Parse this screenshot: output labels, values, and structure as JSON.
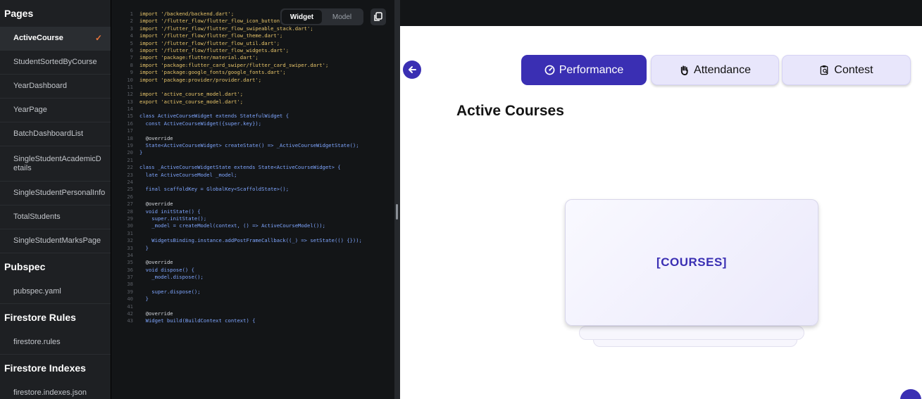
{
  "sidebar": {
    "pages_title": "Pages",
    "pages": [
      {
        "label": "ActiveCourse"
      },
      {
        "label": "StudentSortedByCourse"
      },
      {
        "label": "YearDashboard"
      },
      {
        "label": "YearPage"
      },
      {
        "label": "BatchDashboardList"
      },
      {
        "label": "SingleStudentAcademicDetails"
      },
      {
        "label": "SingleStudentPersonalInfo"
      },
      {
        "label": "TotalStudents"
      },
      {
        "label": "SingleStudentMarksPage"
      }
    ],
    "pubspec_title": "Pubspec",
    "pubspec_file": "pubspec.yaml",
    "rules_title": "Firestore Rules",
    "rules_file": "firestore.rules",
    "indexes_title": "Firestore Indexes",
    "indexes_file": "firestore.indexes.json"
  },
  "code": {
    "toggle": {
      "widget": "Widget",
      "model": "Model"
    },
    "lines": [
      "import '/backend/backend.dart';",
      "import '/flutter_flow/flutter_flow_icon_button.dart';",
      "import '/flutter_flow/flutter_flow_swipeable_stack.dart';",
      "import '/flutter_flow/flutter_flow_theme.dart';",
      "import '/flutter_flow/flutter_flow_util.dart';",
      "import '/flutter_flow/flutter_flow_widgets.dart';",
      "import 'package:flutter/material.dart';",
      "import 'package:flutter_card_swiper/flutter_card_swiper.dart';",
      "import 'package:google_fonts/google_fonts.dart';",
      "import 'package:provider/provider.dart';",
      "",
      "import 'active_course_model.dart';",
      "export 'active_course_model.dart';",
      "",
      "class ActiveCourseWidget extends StatefulWidget {",
      "  const ActiveCourseWidget({super.key});",
      "",
      "  @override",
      "  State<ActiveCourseWidget> createState() => _ActiveCourseWidgetState();",
      "}",
      "",
      "class _ActiveCourseWidgetState extends State<ActiveCourseWidget> {",
      "  late ActiveCourseModel _model;",
      "",
      "  final scaffoldKey = GlobalKey<ScaffoldState>();",
      "",
      "  @override",
      "  void initState() {",
      "    super.initState();",
      "    _model = createModel(context, () => ActiveCourseModel());",
      "",
      "    WidgetsBinding.instance.addPostFrameCallback((_) => setState(() {}));",
      "  }",
      "",
      "  @override",
      "  void dispose() {",
      "    _model.dispose();",
      "",
      "    super.dispose();",
      "  }",
      "",
      "  @override",
      "  Widget build(BuildContext context) {"
    ]
  },
  "preview": {
    "tabs": [
      {
        "label": "Performance",
        "icon": "speedometer-icon"
      },
      {
        "label": "Attendance",
        "icon": "hand-icon"
      },
      {
        "label": "Contest",
        "icon": "clipboard-search-icon"
      }
    ],
    "title": "Active Courses",
    "card_label": "[COURSES]"
  },
  "colors": {
    "accent": "#3a2fb3",
    "tab_unselected": "#e8e6fb",
    "check": "#e8743b"
  }
}
